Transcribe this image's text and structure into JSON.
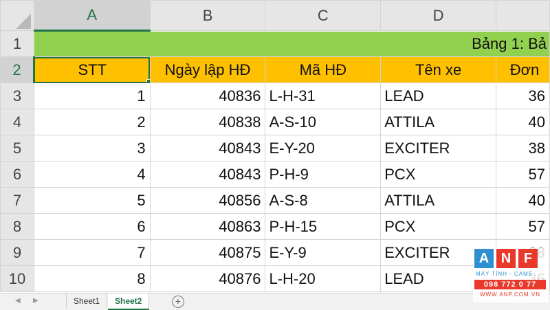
{
  "columns": [
    "A",
    "B",
    "C",
    "D",
    ""
  ],
  "rows": [
    "1",
    "2",
    "3",
    "4",
    "5",
    "6",
    "7",
    "8",
    "9",
    "10"
  ],
  "title_cell": "Bảng 1: Bả",
  "headers": [
    "STT",
    "Ngày lập HĐ",
    "Mã HĐ",
    "Tên xe",
    "Đơn"
  ],
  "data_rows": [
    {
      "stt": "1",
      "ngay": "40836",
      "ma": "L-H-31",
      "ten": "LEAD",
      "don": "36"
    },
    {
      "stt": "2",
      "ngay": "40838",
      "ma": "A-S-10",
      "ten": "ATTILA",
      "don": "40"
    },
    {
      "stt": "3",
      "ngay": "40843",
      "ma": "E-Y-20",
      "ten": "EXCITER",
      "don": "38"
    },
    {
      "stt": "4",
      "ngay": "40843",
      "ma": "P-H-9",
      "ten": "PCX",
      "don": "57"
    },
    {
      "stt": "5",
      "ngay": "40856",
      "ma": "A-S-8",
      "ten": "ATTILA",
      "don": "40"
    },
    {
      "stt": "6",
      "ngay": "40863",
      "ma": "P-H-15",
      "ten": "PCX",
      "don": "57"
    },
    {
      "stt": "7",
      "ngay": "40875",
      "ma": "E-Y-9",
      "ten": "EXCITER",
      "don": "38"
    },
    {
      "stt": "8",
      "ngay": "40876",
      "ma": "L-H-20",
      "ten": "LEAD",
      "don": "36"
    }
  ],
  "tabs": [
    {
      "label": "Sheet1",
      "active": false
    },
    {
      "label": "Sheet2",
      "active": true
    }
  ],
  "add_sheet_icon": "plus-circle-icon",
  "watermark": {
    "letters": [
      "A",
      "N",
      "F"
    ],
    "tagline": "MÁY TÍNH - CAME",
    "phone": "098 772 0 77",
    "site": "WWW.ANP.COM.VN"
  },
  "colors": {
    "title_fill": "#92d050",
    "header_fill": "#ffc000",
    "excel_green": "#217346",
    "logo_blue": "#2f8fd0",
    "logo_red": "#e8392b"
  }
}
